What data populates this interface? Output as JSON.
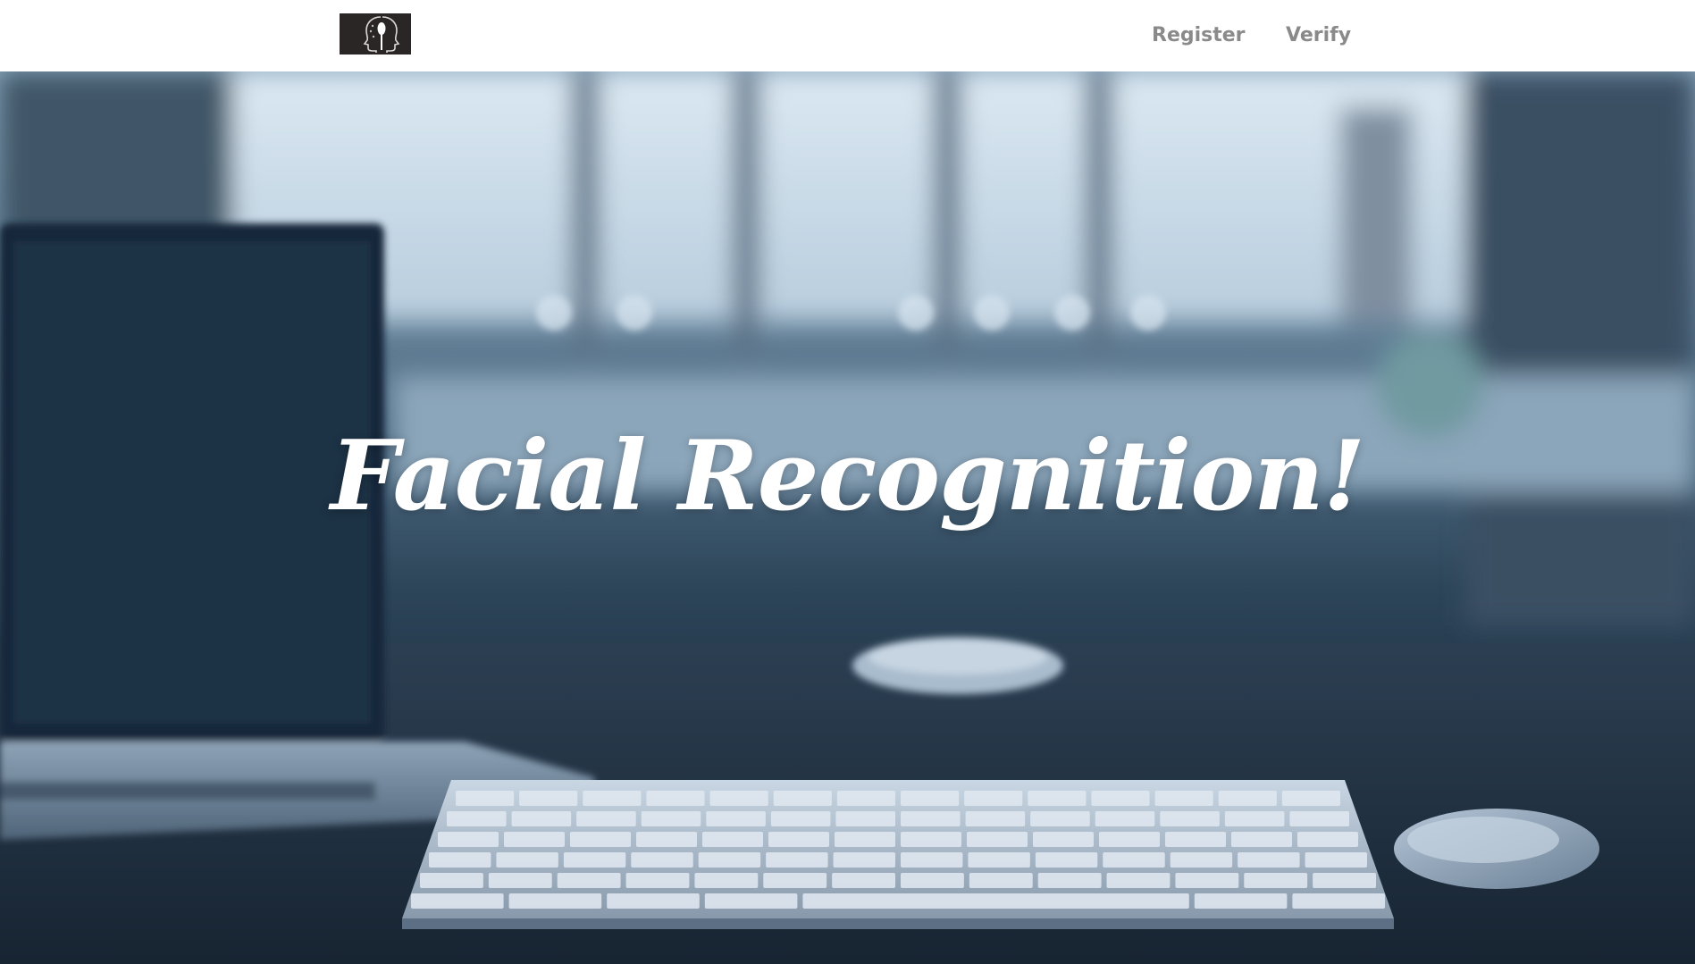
{
  "nav": {
    "logo_icon": "face-profile-logo-icon",
    "register_label": "Register",
    "verify_label": "Verify"
  },
  "hero": {
    "title": "Facial Recognition!",
    "background": "desk-with-laptop-keyboard-mouse-photo"
  },
  "colors": {
    "nav_link": "#8a8a8a",
    "logo_bg": "#2b2626",
    "hero_title": "#ffffff"
  }
}
